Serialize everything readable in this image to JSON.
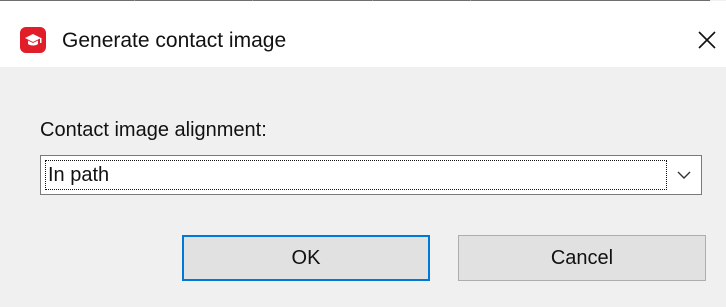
{
  "window": {
    "title": "Generate contact image",
    "app_icon": "graduation-cap-icon",
    "close_icon": "close-icon",
    "accent_color": "#e11d2a"
  },
  "form": {
    "alignment_label": "Contact image alignment:",
    "alignment_value": "In path",
    "dropdown_icon": "chevron-down-icon"
  },
  "buttons": {
    "ok_label": "OK",
    "cancel_label": "Cancel",
    "focus_color": "#0078d7"
  }
}
